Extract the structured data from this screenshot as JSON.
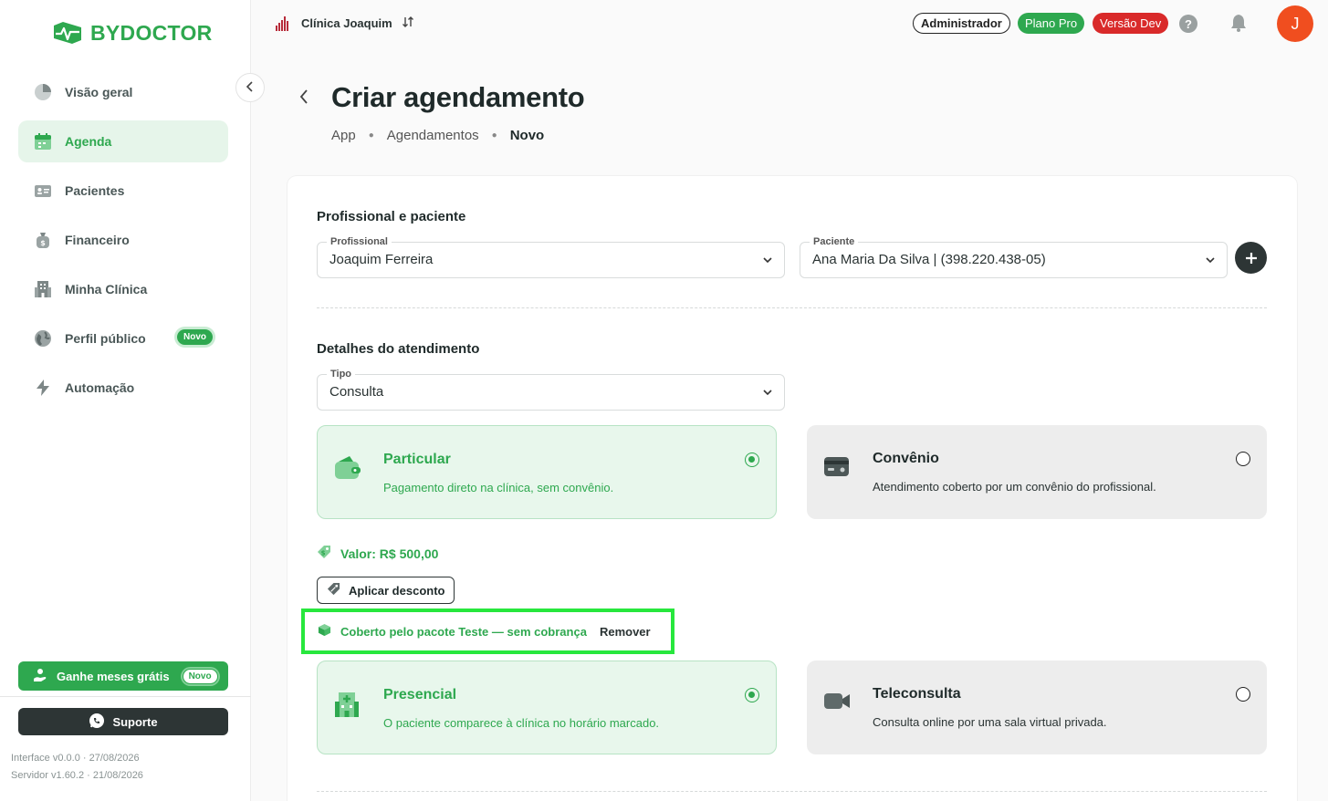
{
  "brand": {
    "name": "BYDOCTOR",
    "accent": "#2ea84f"
  },
  "sidebar": {
    "items": [
      {
        "label": "Visão geral",
        "icon": "pie-chart-icon"
      },
      {
        "label": "Agenda",
        "icon": "calendar-icon",
        "active": true
      },
      {
        "label": "Pacientes",
        "icon": "id-card-icon"
      },
      {
        "label": "Financeiro",
        "icon": "money-bag-icon"
      },
      {
        "label": "Minha Clínica",
        "icon": "building-icon"
      },
      {
        "label": "Perfil público",
        "icon": "globe-icon",
        "badge": "Novo"
      },
      {
        "label": "Automação",
        "icon": "lightning-icon"
      }
    ],
    "promo": {
      "label": "Ganhe meses grátis",
      "badge": "Novo"
    },
    "support_label": "Suporte",
    "interface_version": "Interface v0.0.0 · 27/08/2026",
    "server_version": "Servidor v1.60.2 · 21/08/2026"
  },
  "header": {
    "clinic_name": "Clínica Joaquim",
    "role": "Administrador",
    "plan": "Plano Pro",
    "version": "Versão Dev",
    "help": "?",
    "avatar_initial": "J"
  },
  "page": {
    "title": "Criar agendamento",
    "breadcrumb": [
      "App",
      "Agendamentos",
      "Novo"
    ]
  },
  "form": {
    "section1_title": "Profissional e paciente",
    "profissional": {
      "label": "Profissional",
      "value": "Joaquim Ferreira"
    },
    "paciente": {
      "label": "Paciente",
      "value": "Ana Maria Da Silva | (398.220.438-05)"
    },
    "section2_title": "Detalhes do atendimento",
    "tipo": {
      "label": "Tipo",
      "value": "Consulta"
    },
    "payment_options": [
      {
        "title": "Particular",
        "desc": "Pagamento direto na clínica, sem convênio.",
        "selected": true,
        "icon": "wallet-icon"
      },
      {
        "title": "Convênio",
        "desc": "Atendimento coberto por um convênio do profissional.",
        "selected": false,
        "icon": "insurance-card-icon"
      }
    ],
    "valor": "Valor: R$ 500,00",
    "discount_label": "Aplicar desconto",
    "covered_text": "Coberto pelo pacote Teste — sem cobrança",
    "remove_label": "Remover",
    "mode_options": [
      {
        "title": "Presencial",
        "desc": "O paciente comparece à clínica no horário marcado.",
        "selected": true,
        "icon": "hospital-icon"
      },
      {
        "title": "Teleconsulta",
        "desc": "Consulta online por uma sala virtual privada.",
        "selected": false,
        "icon": "video-camera-icon"
      }
    ]
  }
}
